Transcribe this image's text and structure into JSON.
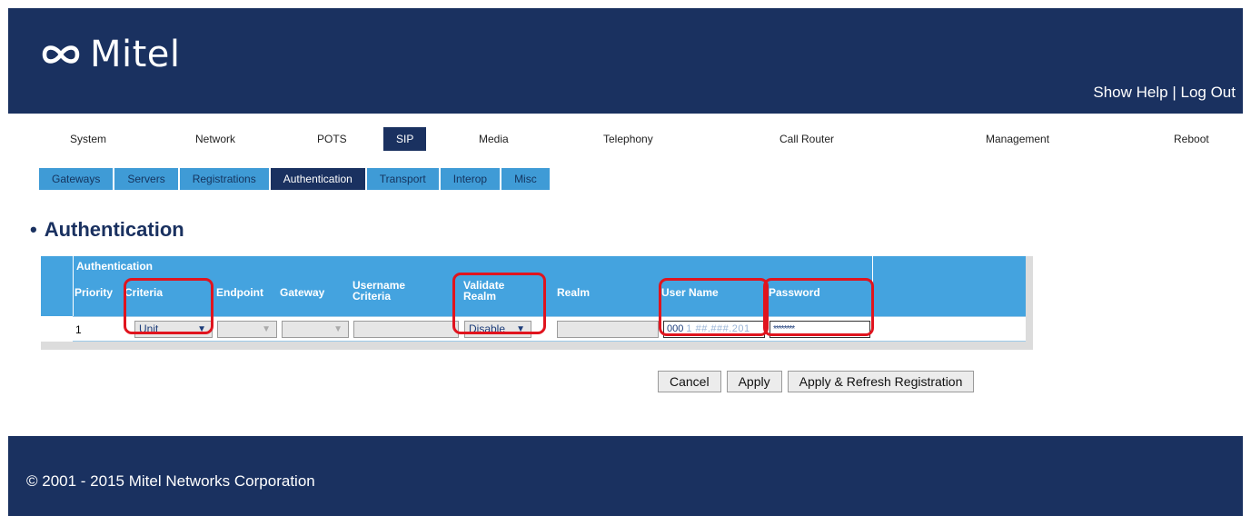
{
  "brand": {
    "name": "Mitel",
    "logo_icon": "mitel-infinity-icon"
  },
  "header": {
    "show_help": "Show Help",
    "separator": "|",
    "log_out": "Log Out"
  },
  "top_nav": [
    {
      "label": "System"
    },
    {
      "label": "Network"
    },
    {
      "label": "POTS"
    },
    {
      "label": "SIP",
      "active": true
    },
    {
      "label": "Media"
    },
    {
      "label": "Telephony"
    },
    {
      "label": "Call Router"
    },
    {
      "label": "Management"
    },
    {
      "label": "Reboot"
    }
  ],
  "sub_nav": [
    {
      "label": "Gateways"
    },
    {
      "label": "Servers"
    },
    {
      "label": "Registrations"
    },
    {
      "label": "Authentication",
      "active": true
    },
    {
      "label": "Transport"
    },
    {
      "label": "Interop"
    },
    {
      "label": "Misc"
    }
  ],
  "page": {
    "bullet": "•",
    "title": "Authentication"
  },
  "table": {
    "group_label": "Authentication",
    "columns": {
      "priority": "Priority",
      "criteria": "Criteria",
      "endpoint": "Endpoint",
      "gateway": "Gateway",
      "username_criteria_1": "Username",
      "username_criteria_2": "Criteria",
      "validate_realm_1": "Validate",
      "validate_realm_2": "Realm",
      "realm": "Realm",
      "user_name": "User Name",
      "password": "Password"
    },
    "rows": [
      {
        "priority": "1",
        "criteria": "Unit",
        "endpoint": "",
        "gateway": "",
        "username_criteria": "",
        "validate_realm": "Disable",
        "realm": "",
        "user_name_prefix": "000",
        "user_name_blurred": "1 ##.###.201",
        "password": "********"
      }
    ]
  },
  "buttons": {
    "cancel": "Cancel",
    "apply": "Apply",
    "apply_refresh": "Apply & Refresh Registration"
  },
  "footer": {
    "copyright": "© 2001 - 2015 Mitel Networks Corporation"
  },
  "colors": {
    "navy": "#1a3160",
    "tab_blue": "#3f9bd6",
    "table_header_blue": "#44a3df",
    "highlight_red": "#e0141e"
  }
}
